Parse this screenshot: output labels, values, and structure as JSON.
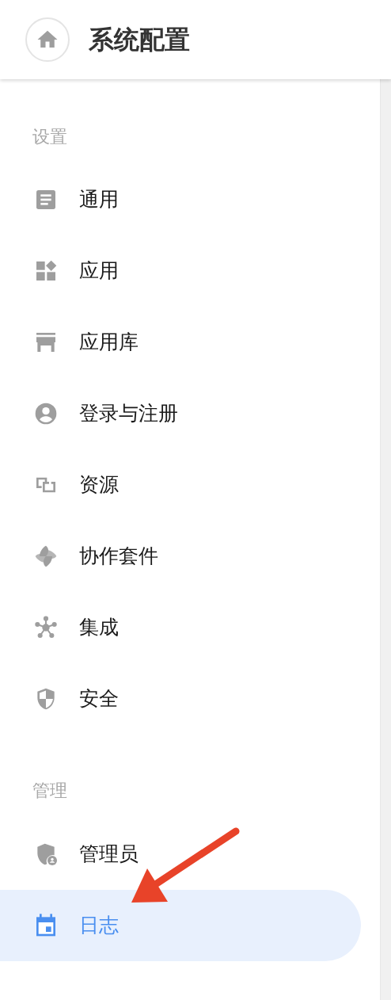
{
  "header": {
    "title": "系统配置"
  },
  "sections": [
    {
      "title": "设置",
      "items": [
        {
          "label": "通用",
          "selected": false
        },
        {
          "label": "应用",
          "selected": false
        },
        {
          "label": "应用库",
          "selected": false
        },
        {
          "label": "登录与注册",
          "selected": false
        },
        {
          "label": "资源",
          "selected": false
        },
        {
          "label": "协作套件",
          "selected": false
        },
        {
          "label": "集成",
          "selected": false
        },
        {
          "label": "安全",
          "selected": false
        }
      ]
    },
    {
      "title": "管理",
      "items": [
        {
          "label": "管理员",
          "selected": false
        },
        {
          "label": "日志",
          "selected": true
        }
      ]
    }
  ]
}
